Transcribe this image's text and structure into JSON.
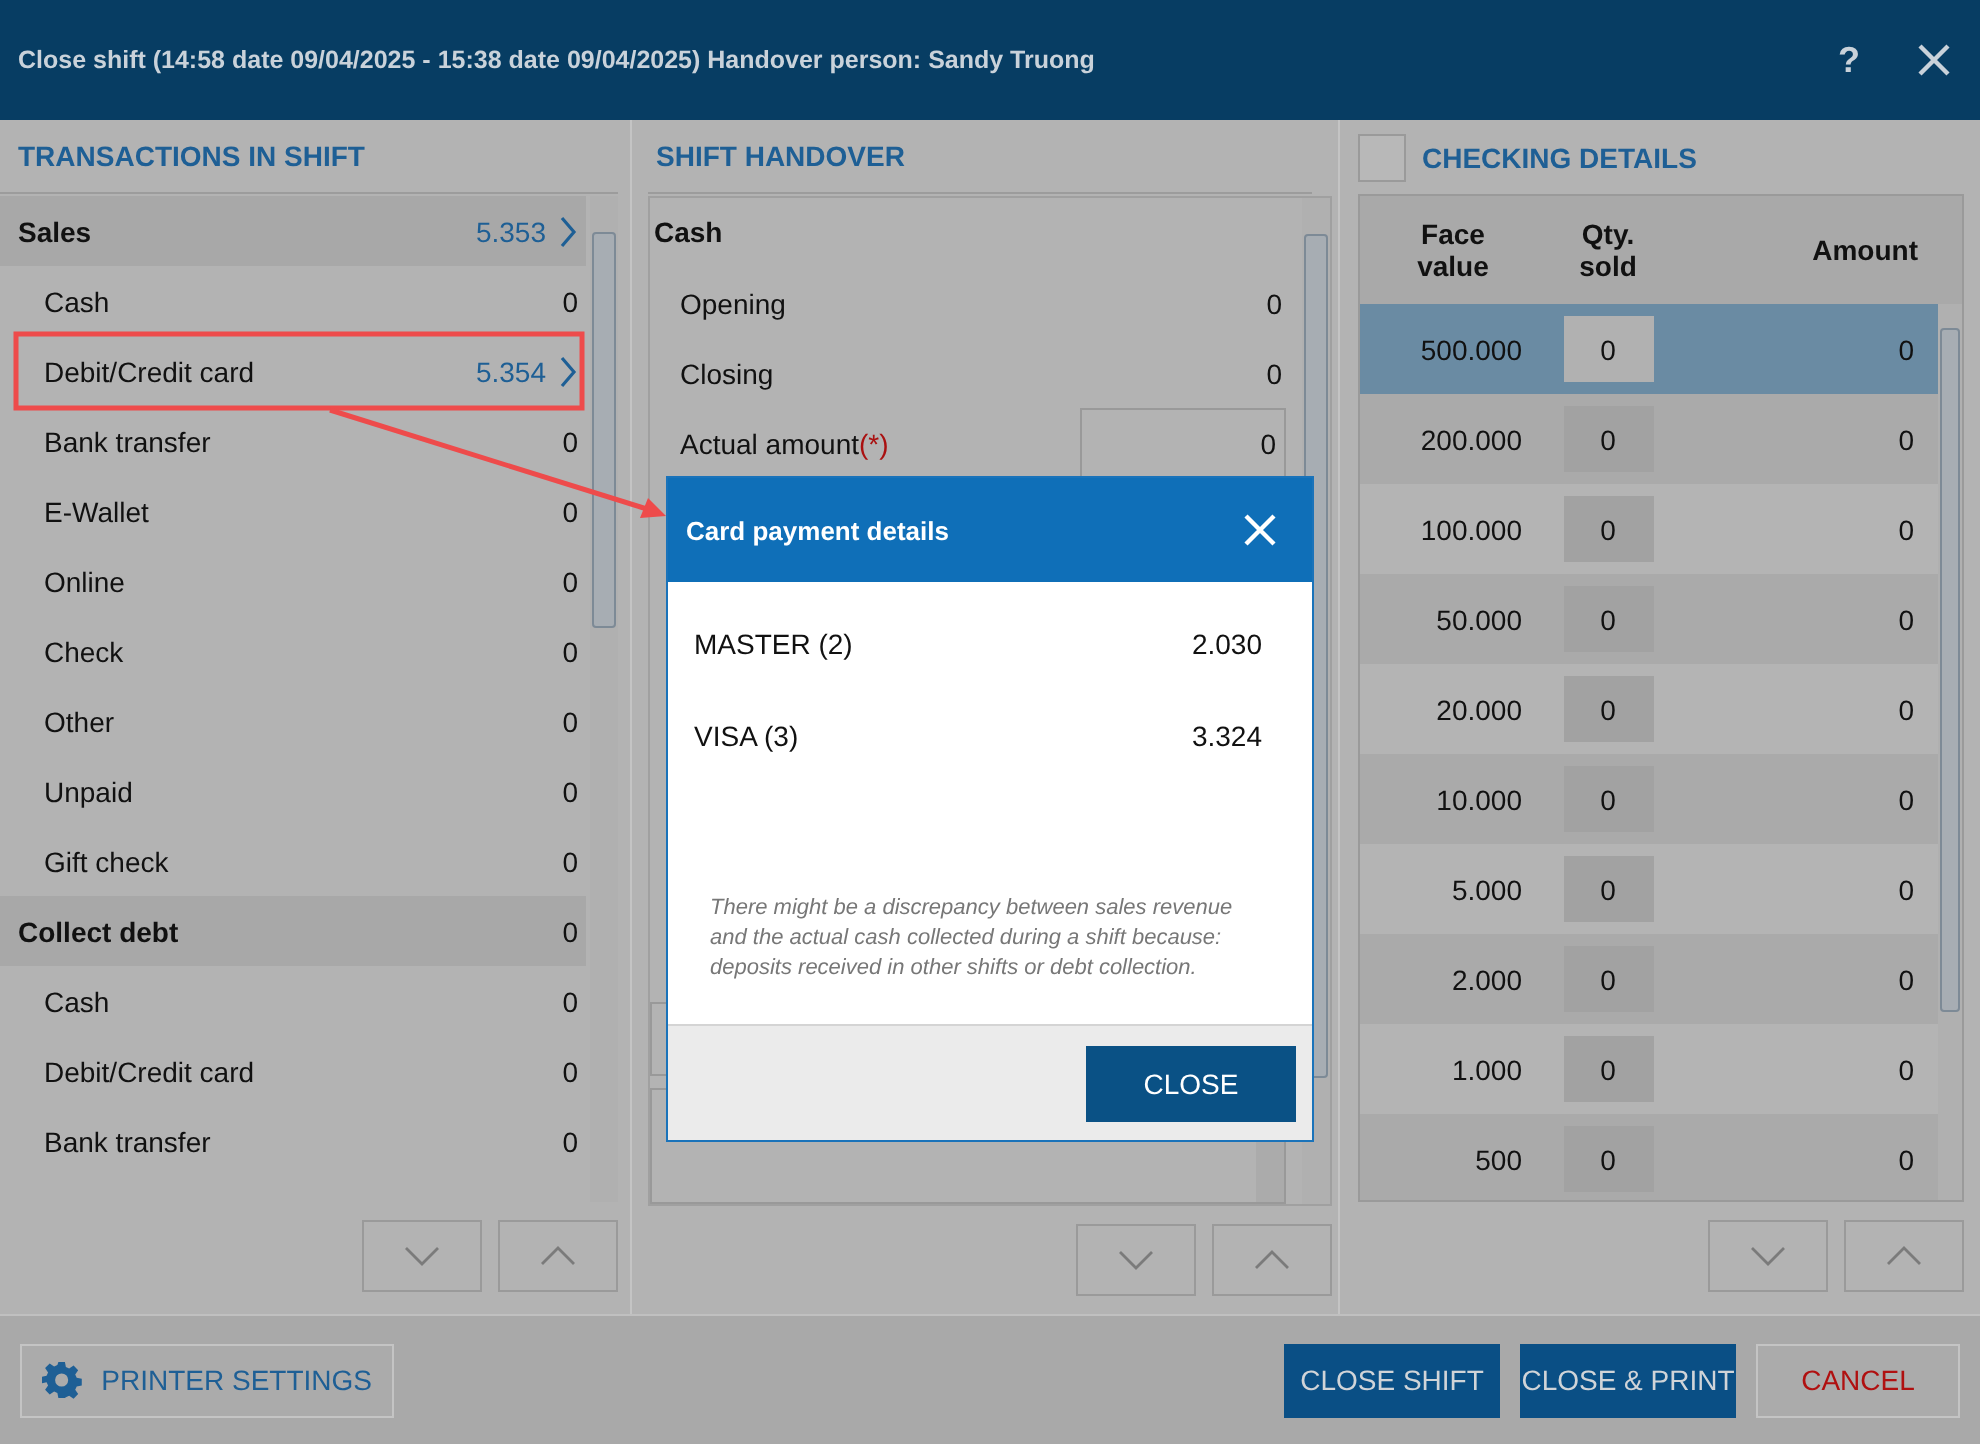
{
  "window": {
    "title": "Close shift (14:58 date 09/04/2025 - 15:38 date 09/04/2025) Handover person: Sandy Truong",
    "help": "?"
  },
  "transactions": {
    "title": "TRANSACTIONS IN SHIFT",
    "groups": [
      {
        "label": "Sales",
        "value": "5.353",
        "expandable": true,
        "items": [
          {
            "label": "Cash",
            "value": "0",
            "expandable": false
          },
          {
            "label": "Debit/Credit card",
            "value": "5.354",
            "expandable": true
          },
          {
            "label": "Bank transfer",
            "value": "0",
            "expandable": false
          },
          {
            "label": "E-Wallet",
            "value": "0",
            "expandable": false
          },
          {
            "label": "Online",
            "value": "0",
            "expandable": false
          },
          {
            "label": "Check",
            "value": "0",
            "expandable": false
          },
          {
            "label": "Other",
            "value": "0",
            "expandable": false
          },
          {
            "label": "Unpaid",
            "value": "0",
            "expandable": false
          },
          {
            "label": "Gift check",
            "value": "0",
            "expandable": false
          }
        ]
      },
      {
        "label": "Collect debt",
        "value": "0",
        "expandable": false,
        "items": [
          {
            "label": "Cash",
            "value": "0",
            "expandable": false
          },
          {
            "label": "Debit/Credit card",
            "value": "0",
            "expandable": false
          },
          {
            "label": "Bank transfer",
            "value": "0",
            "expandable": false
          }
        ]
      }
    ]
  },
  "handover": {
    "title": "SHIFT HANDOVER",
    "section": "Cash",
    "rows": [
      {
        "kind": "text",
        "label": "Opening",
        "value": "0"
      },
      {
        "kind": "text",
        "label": "Closing",
        "value": "0"
      },
      {
        "kind": "input",
        "label": "Actual amount",
        "required": "(*)",
        "value": "0"
      }
    ]
  },
  "checking": {
    "checked": false,
    "title": "CHECKING DETAILS",
    "columns": [
      "Face value",
      "Qty. sold",
      "Amount"
    ],
    "rows": [
      {
        "face": "500.000",
        "qty": "0",
        "amount": "0",
        "selected": true
      },
      {
        "face": "200.000",
        "qty": "0",
        "amount": "0",
        "selected": false
      },
      {
        "face": "100.000",
        "qty": "0",
        "amount": "0",
        "selected": false
      },
      {
        "face": "50.000",
        "qty": "0",
        "amount": "0",
        "selected": false
      },
      {
        "face": "20.000",
        "qty": "0",
        "amount": "0",
        "selected": false
      },
      {
        "face": "10.000",
        "qty": "0",
        "amount": "0",
        "selected": false
      },
      {
        "face": "5.000",
        "qty": "0",
        "amount": "0",
        "selected": false
      },
      {
        "face": "2.000",
        "qty": "0",
        "amount": "0",
        "selected": false
      },
      {
        "face": "1.000",
        "qty": "0",
        "amount": "0",
        "selected": false
      },
      {
        "face": "500",
        "qty": "0",
        "amount": "0",
        "selected": false
      }
    ]
  },
  "modal": {
    "title": "Card payment details",
    "rows": [
      {
        "label": "MASTER (2)",
        "value": "2.030"
      },
      {
        "label": "VISA (3)",
        "value": "3.324"
      }
    ],
    "note": "There might be a discrepancy between sales revenue and the actual cash collected during a shift because: deposits received in other shifts or debt collection.",
    "button": "CLOSE"
  },
  "footer": {
    "printer": "PRINTER SETTINGS",
    "buttons": [
      {
        "label": "CLOSE SHIFT",
        "kind": "primary"
      },
      {
        "label": "CLOSE & PRINT",
        "kind": "primary"
      },
      {
        "label": "CANCEL",
        "kind": "cancel"
      }
    ]
  }
}
